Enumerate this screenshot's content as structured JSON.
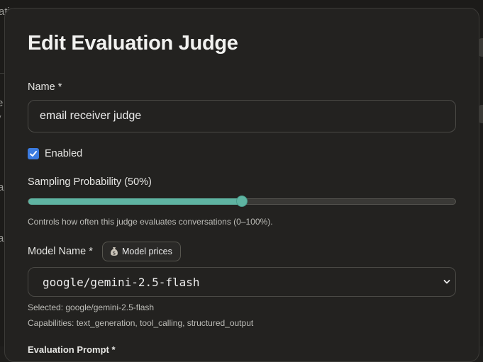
{
  "background": {
    "fragments": [
      {
        "text": "ati"
      },
      {
        "text": "e"
      },
      {
        "text": "v"
      },
      {
        "text": "a"
      },
      {
        "text": "a"
      }
    ]
  },
  "modal": {
    "title": "Edit Evaluation Judge",
    "name": {
      "label": "Name *",
      "value": "email receiver judge"
    },
    "enabled": {
      "label": "Enabled",
      "checked": true
    },
    "sampling": {
      "label": "Sampling Probability (50%)",
      "value_percent": 50,
      "helper": "Controls how often this judge evaluates conversations (0–100%)."
    },
    "model": {
      "label": "Model Name *",
      "prices_button": "Model prices",
      "prices_icon": "money-bag-icon",
      "selected_value": "google/gemini-2.5-flash",
      "selected_text": "Selected: google/gemini-2.5-flash",
      "capabilities": "Capabilities: text_generation, tool_calling, structured_output"
    },
    "next_section_label": "Evaluation Prompt *"
  },
  "colors": {
    "accent": "#5fb4a2",
    "checkbox": "#3b7be0",
    "surface": "#232220"
  }
}
